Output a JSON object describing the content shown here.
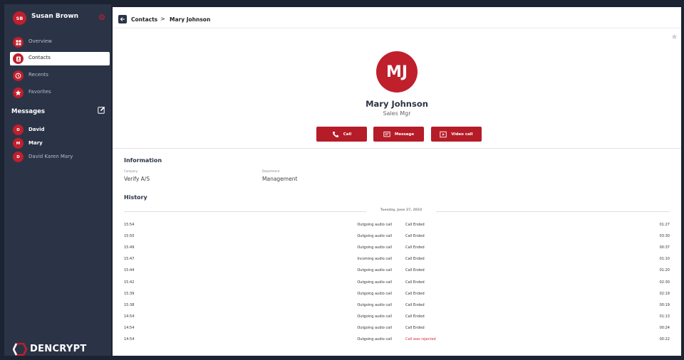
{
  "user": {
    "initials": "SB",
    "name": "Susan Brown"
  },
  "nav": [
    {
      "label": "Overview",
      "icon": "grid-icon"
    },
    {
      "label": "Contacts",
      "icon": "contacts-icon",
      "active": true
    },
    {
      "label": "Recents",
      "icon": "clock-icon"
    },
    {
      "label": "Favorites",
      "icon": "star-icon"
    }
  ],
  "messages": {
    "title": "Messages",
    "items": [
      {
        "initial": "D",
        "label": "David"
      },
      {
        "initial": "M",
        "label": "Mary"
      },
      {
        "initial": "D",
        "label": "David Karen Mary"
      }
    ]
  },
  "logo": {
    "text": "DENCRYPT"
  },
  "breadcrumb": {
    "parent": "Contacts",
    "separator": ">",
    "current": "Mary Johnson"
  },
  "contact": {
    "initials": "MJ",
    "name": "Mary Johnson",
    "title": "Sales Mgr"
  },
  "actions": {
    "call": "Call",
    "message": "Message",
    "video": "Video call"
  },
  "information": {
    "title": "Information",
    "company_label": "Company",
    "company": "Verify A/S",
    "department_label": "Department",
    "department": "Management"
  },
  "history": {
    "title": "History",
    "date": "Tuesday, June 27, 2023",
    "rows": [
      {
        "time": "15:54",
        "type": "Outgoing audio call",
        "status": "Call Ended",
        "duration": "01:27"
      },
      {
        "time": "15:50",
        "type": "Outgoing audio call",
        "status": "Call Ended",
        "duration": "03:30"
      },
      {
        "time": "15:49",
        "type": "Outgoing audio call",
        "status": "Call Ended",
        "duration": "00:37"
      },
      {
        "time": "15:47",
        "type": "Incoming audio call",
        "status": "Call Ended",
        "duration": "01:10"
      },
      {
        "time": "15:44",
        "type": "Outgoing audio call",
        "status": "Call Ended",
        "duration": "01:20"
      },
      {
        "time": "15:42",
        "type": "Outgoing audio call",
        "status": "Call Ended",
        "duration": "02:30"
      },
      {
        "time": "15:39",
        "type": "Outgoing audio call",
        "status": "Call Ended",
        "duration": "02:19"
      },
      {
        "time": "15:38",
        "type": "Outgoing audio call",
        "status": "Call Ended",
        "duration": "00:19"
      },
      {
        "time": "14:54",
        "type": "Outgoing audio call",
        "status": "Call Ended",
        "duration": "01:13"
      },
      {
        "time": "14:54",
        "type": "Outgoing audio call",
        "status": "Call Ended",
        "duration": "00:24"
      },
      {
        "time": "14:54",
        "type": "Outgoing audio call",
        "status": "Call was rejected",
        "duration": "00:22",
        "rejected": true
      }
    ]
  },
  "colors": {
    "brand_red": "#c01f2c",
    "sidebar": "#2b3446",
    "rejected": "#d0303a"
  }
}
